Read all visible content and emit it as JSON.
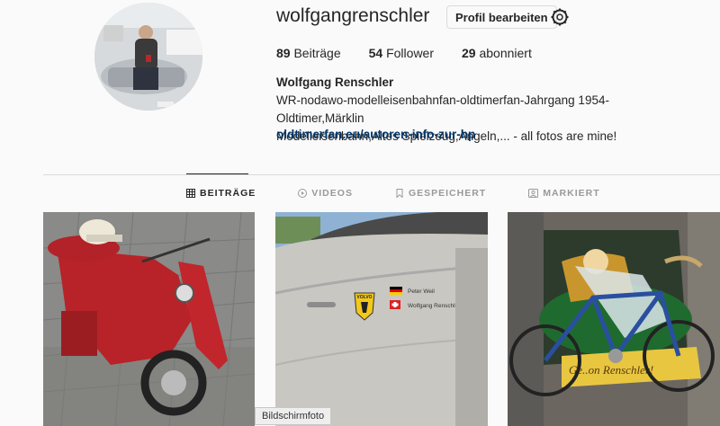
{
  "profile": {
    "username": "wolfgangrenschler",
    "edit_label": "Profil bearbeiten",
    "stats": [
      {
        "count": "89",
        "label": "Beiträge"
      },
      {
        "count": "54",
        "label": "Follower"
      },
      {
        "count": "29",
        "label": "abonniert"
      }
    ],
    "full_name": "Wolfgang Renschler",
    "bio_line1": "WR-nodawo-modelleisenbahnfan-oldtimerfan-Jahrgang 1954-Oldtimer,Märklin",
    "bio_line2": "Modelleisenbahn,Altes Spielzeug,Angeln,... - all fotos are mine!",
    "link": "oldtimerfan.eu/autoren-info-zur-hp"
  },
  "tabs": [
    {
      "label": "BEITRÄGE",
      "icon": "grid-icon",
      "active": true
    },
    {
      "label": "VIDEOS",
      "icon": "play-icon",
      "active": false
    },
    {
      "label": "GESPEICHERT",
      "icon": "bookmark-icon",
      "active": false
    },
    {
      "label": "MARKIERT",
      "icon": "tag-icon",
      "active": false
    }
  ],
  "posts": {
    "post2_sticker_line1": "Peter Weil",
    "post2_sticker_line2": "Wolfgang Renschler",
    "post2_badge": "VOLVO",
    "post3_sign": "Ge..on Renschler!"
  },
  "tooltip": "Bildschirmfoto",
  "colors": {
    "link": "#003569",
    "text": "#262626",
    "muted": "#999999",
    "background": "#fafafa"
  }
}
